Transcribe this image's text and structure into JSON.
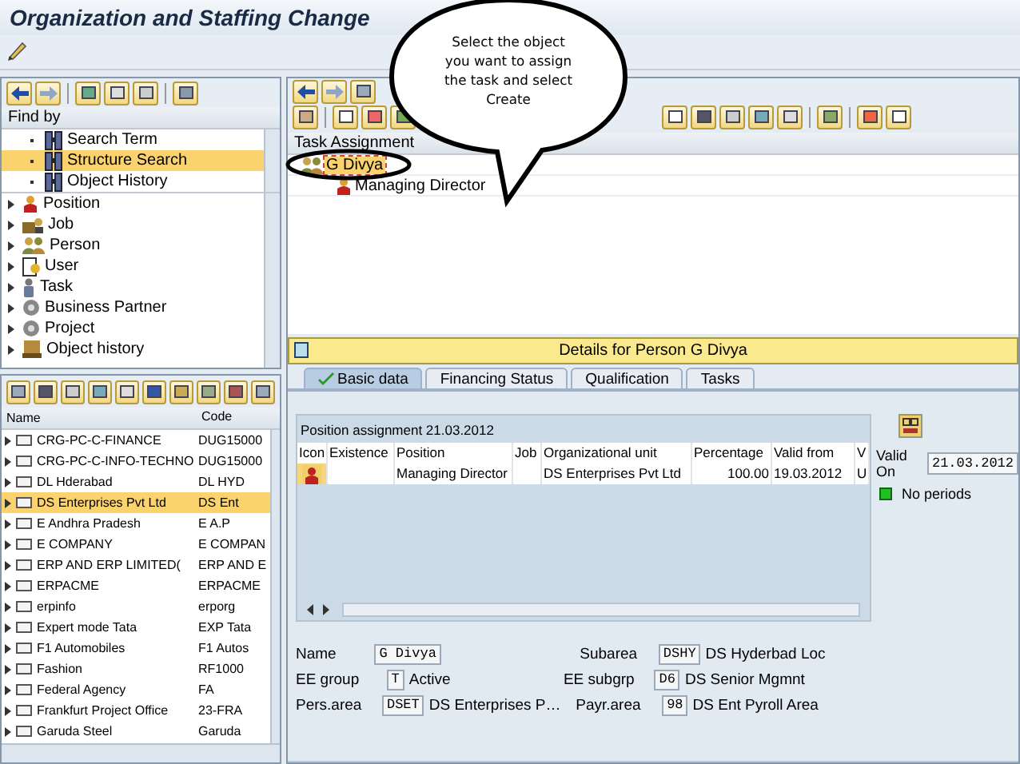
{
  "window": {
    "title": "Organization and Staffing Change"
  },
  "callout": {
    "text": "Select the object you want to assign the task and select Create"
  },
  "find_by": {
    "header": "Find by",
    "items": [
      {
        "label": "Search Term",
        "selected": false
      },
      {
        "label": "Structure Search",
        "selected": true
      },
      {
        "label": "Object History",
        "selected": false
      }
    ]
  },
  "object_types": [
    {
      "label": "Position",
      "kind": "position"
    },
    {
      "label": "Job",
      "kind": "job"
    },
    {
      "label": "Person",
      "kind": "person"
    },
    {
      "label": "User",
      "kind": "user"
    },
    {
      "label": "Task",
      "kind": "task"
    },
    {
      "label": "Business Partner",
      "kind": "partner"
    },
    {
      "label": "Project",
      "kind": "project"
    },
    {
      "label": "Object history",
      "kind": "history"
    }
  ],
  "results": {
    "columns": [
      "Name",
      "Code"
    ],
    "rows": [
      {
        "name": "CRG-PC-C-FINANCE",
        "code": "DUG15000",
        "selected": false
      },
      {
        "name": "CRG-PC-C-INFO-TECHNO",
        "code": "DUG15000",
        "selected": false
      },
      {
        "name": "DL Hderabad",
        "code": "DL HYD",
        "selected": false
      },
      {
        "name": "DS Enterprises Pvt Ltd",
        "code": "DS Ent",
        "selected": true
      },
      {
        "name": "E Andhra Pradesh",
        "code": "E A.P",
        "selected": false
      },
      {
        "name": "E COMPANY",
        "code": "E COMPAN",
        "selected": false
      },
      {
        "name": "ERP AND ERP LIMITED(",
        "code": "ERP AND E",
        "selected": false
      },
      {
        "name": "ERPACME",
        "code": "ERPACME",
        "selected": false
      },
      {
        "name": "erpinfo",
        "code": "erporg",
        "selected": false
      },
      {
        "name": "Expert mode Tata",
        "code": "EXP Tata",
        "selected": false
      },
      {
        "name": "F1 Automobiles",
        "code": "F1 Autos",
        "selected": false
      },
      {
        "name": "Fashion",
        "code": "RF1000",
        "selected": false
      },
      {
        "name": "Federal Agency",
        "code": "FA",
        "selected": false
      },
      {
        "name": "Frankfurt Project Office",
        "code": "23-FRA",
        "selected": false
      },
      {
        "name": "Garuda Steel",
        "code": "Garuda",
        "selected": false
      }
    ]
  },
  "overview": {
    "header": "Task Assignment",
    "tree": [
      {
        "label": "G Divya",
        "kind": "person",
        "selected": true,
        "children": [
          {
            "label": "Managing Director",
            "kind": "position",
            "selected": false
          }
        ]
      }
    ]
  },
  "details": {
    "title": "Details for Person G Divya",
    "tabs": [
      {
        "label": "Basic data",
        "selected": true
      },
      {
        "label": "Financing Status",
        "selected": false
      },
      {
        "label": "Qualification",
        "selected": false
      },
      {
        "label": "Tasks",
        "selected": false
      }
    ],
    "assignment": {
      "title": "Position assignment 21.03.2012",
      "columns": [
        "Icon",
        "Existence",
        "Position",
        "Job",
        "Organizational unit",
        "Percentage",
        "Valid from",
        "V"
      ],
      "rows": [
        {
          "cells": [
            null,
            null,
            "Managing Director",
            null,
            "DS Enterprises Pvt Ltd",
            "100.00",
            "19.03.2012",
            "U"
          ]
        }
      ]
    },
    "valid_on": {
      "label": "Valid On",
      "value": "21.03.2012"
    },
    "status": {
      "text": "No periods"
    },
    "fields": [
      {
        "label": "Name",
        "code": "G Divya"
      },
      {
        "label": "Subarea",
        "code": "DSHY",
        "text": "DS Hyderbad Loc"
      },
      {
        "label": "EE group",
        "code": "T",
        "text": "Active"
      },
      {
        "label": "EE subgrp",
        "code": "D6",
        "text": "DS Senior Mgmnt"
      },
      {
        "label": "Pers.area",
        "code": "DSET",
        "text": "DS Enterprises P…"
      },
      {
        "label": "Payr.area",
        "code": "98",
        "text": "DS Ent Pyroll Area"
      }
    ]
  }
}
